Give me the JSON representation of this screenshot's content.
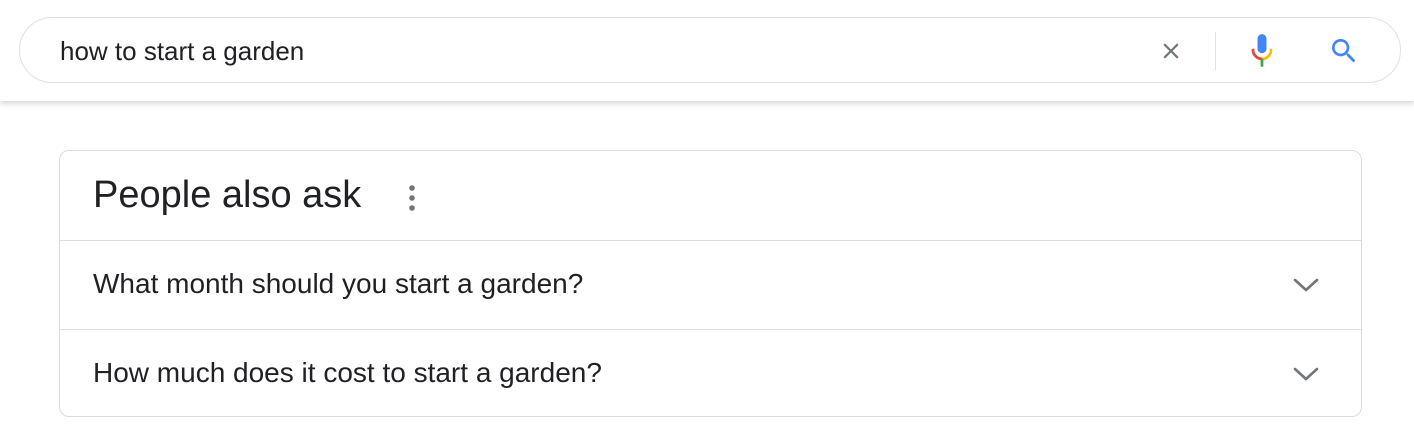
{
  "search": {
    "query": "how to start a garden",
    "icons": {
      "clear": "close-icon",
      "voice": "microphone-icon",
      "submit": "search-icon"
    }
  },
  "people_also_ask": {
    "title": "People also ask",
    "menu_icon": "more-vert-icon",
    "questions": [
      {
        "text": "What month should you start a garden?",
        "icon": "chevron-down-icon"
      },
      {
        "text": "How much does it cost to start a garden?",
        "icon": "chevron-down-icon"
      }
    ]
  },
  "colors": {
    "text": "#202124",
    "icon_gray": "#70757a",
    "border": "#dadce0",
    "google_blue": "#4285f4",
    "google_red": "#ea4335",
    "google_yellow": "#fbbc05",
    "google_green": "#34a853"
  }
}
